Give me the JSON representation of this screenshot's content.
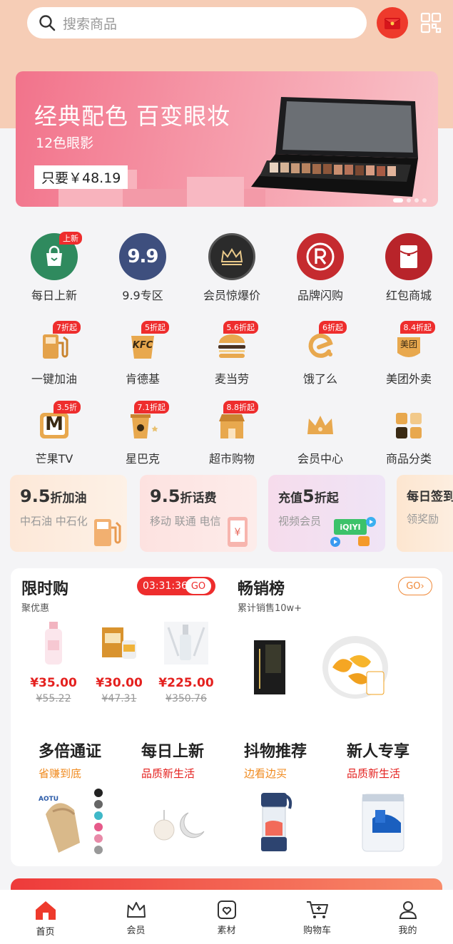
{
  "search": {
    "placeholder": "搜索商品"
  },
  "banner": {
    "title": "经典配色 百变眼妆",
    "subtitle": "12色眼影",
    "price": "只要￥48.19"
  },
  "grid": [
    {
      "label": "每日上新",
      "tag": "上新"
    },
    {
      "label": "9.9专区",
      "icon_text": "9.9"
    },
    {
      "label": "会员惊爆价"
    },
    {
      "label": "品牌闪购"
    },
    {
      "label": "红包商城"
    },
    {
      "label": "一键加油",
      "tag": "7折起"
    },
    {
      "label": "肯德基",
      "tag": "5折起",
      "icon_text": "KFC"
    },
    {
      "label": "麦当劳",
      "tag": "5.6折起"
    },
    {
      "label": "饿了么",
      "tag": "6折起"
    },
    {
      "label": "美团外卖",
      "tag": "8.4折起",
      "icon_text": "美团"
    },
    {
      "label": "芒果TV",
      "tag": "3.5折",
      "icon_text": "M"
    },
    {
      "label": "星巴克",
      "tag": "7.1折起"
    },
    {
      "label": "超市购物",
      "tag": "8.8折起"
    },
    {
      "label": "会员中心"
    },
    {
      "label": "商品分类"
    }
  ],
  "cards": [
    {
      "big": "9.5",
      "title": "折加油",
      "sub": "中石油 中石化"
    },
    {
      "big": "9.5",
      "title": "折话费",
      "sub": "移动 联通 电信"
    },
    {
      "pre": "充值",
      "big": "5",
      "title": "折起",
      "sub": "视频会员",
      "icon_text": "iQIYI"
    },
    {
      "title": "每日签到",
      "sub": "领奖励"
    }
  ],
  "flash": {
    "title": "限时购",
    "sub": "聚优惠",
    "timer": "03:31:36",
    "go": "GO",
    "products": [
      {
        "price": "¥35.00",
        "old": "¥55.22"
      },
      {
        "price": "¥30.00",
        "old": "¥47.31"
      },
      {
        "price": "¥225.00",
        "old": "¥350.76"
      }
    ]
  },
  "rank": {
    "title": "畅销榜",
    "sub": "累计销售10w+",
    "go": "GO"
  },
  "promos": [
    {
      "title": "多倍通证",
      "sub": "省赚到底",
      "color": "#f08a1e"
    },
    {
      "title": "每日上新",
      "sub": "品质新生活",
      "color": "#e4211f"
    },
    {
      "title": "抖物推荐",
      "sub": "边看边买",
      "color": "#f08a1e"
    },
    {
      "title": "新人专享",
      "sub": "品质新生活",
      "color": "#e4211f"
    }
  ],
  "promo_brand": "AOTU",
  "tabs": [
    {
      "label": "首页",
      "active": true
    },
    {
      "label": "会员"
    },
    {
      "label": "素材"
    },
    {
      "label": "购物车"
    },
    {
      "label": "我的"
    }
  ],
  "colors": {
    "accent": "#ee2d2d",
    "orange": "#f08a1e"
  }
}
